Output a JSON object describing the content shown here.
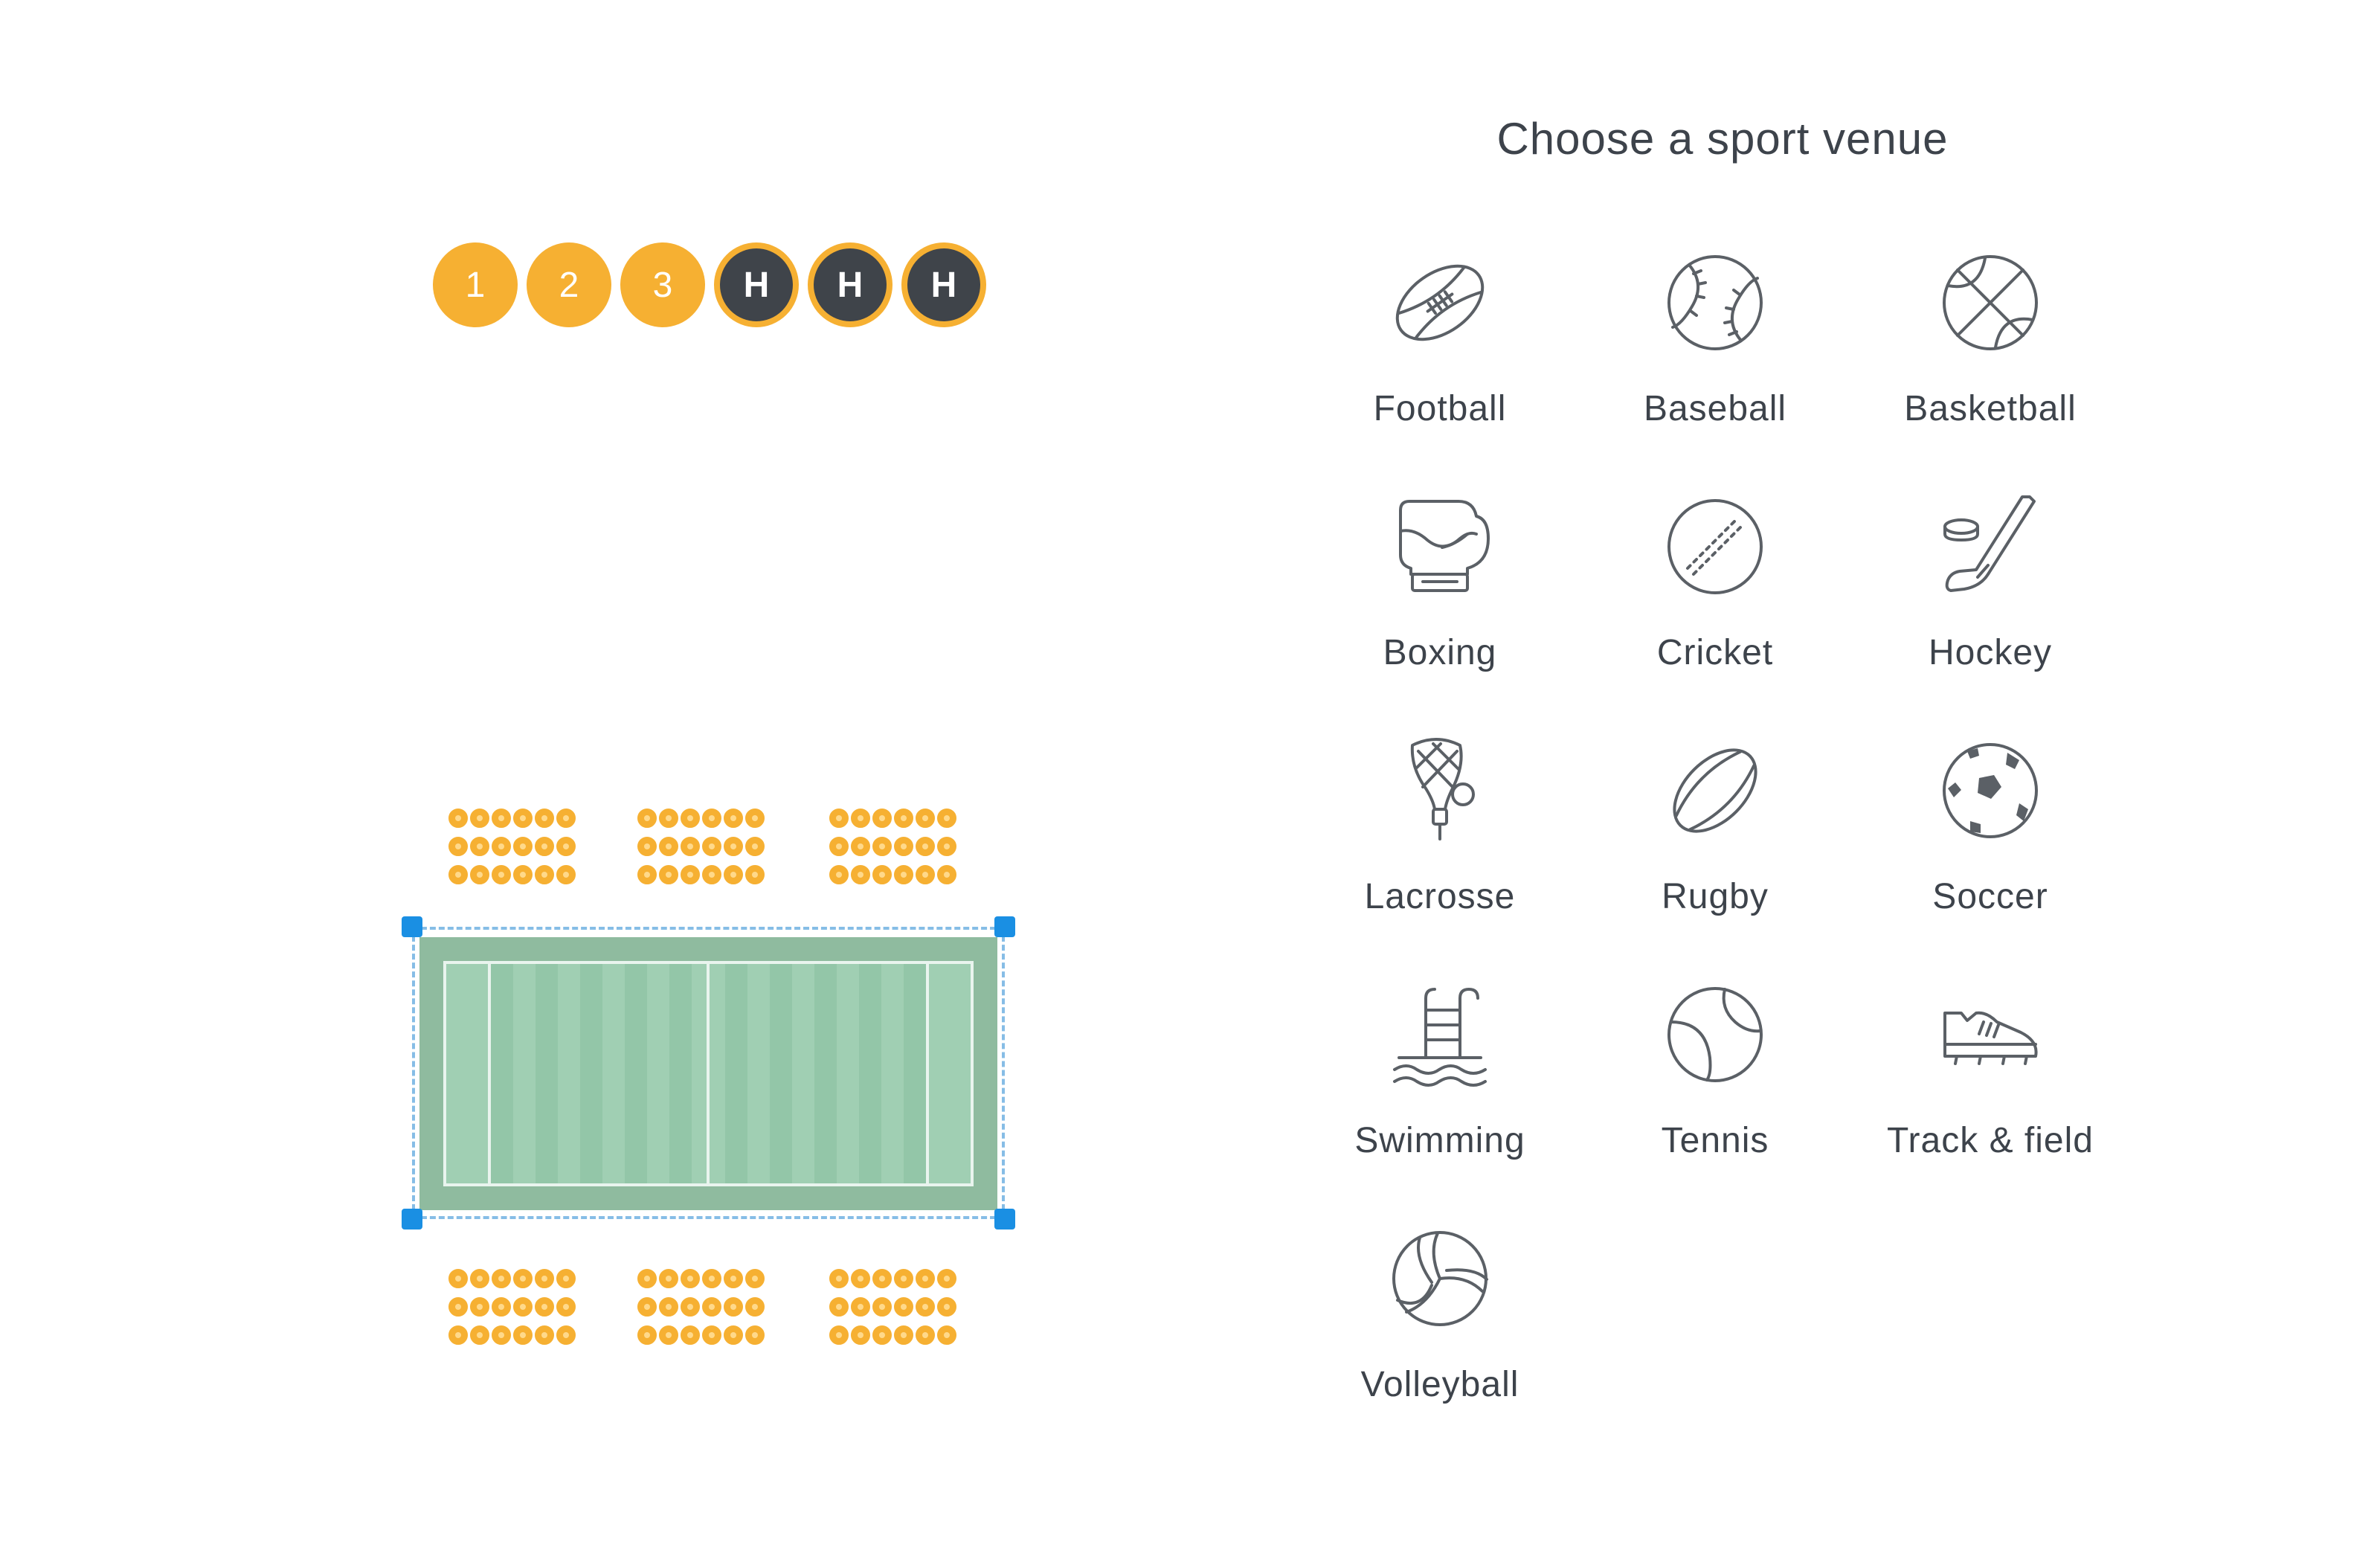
{
  "markers": [
    "1",
    "2",
    "3",
    "H",
    "H",
    "H"
  ],
  "panel": {
    "title": "Choose a sport venue",
    "venues": [
      {
        "label": "Football",
        "icon": "football-icon"
      },
      {
        "label": "Baseball",
        "icon": "baseball-icon"
      },
      {
        "label": "Basketball",
        "icon": "basketball-icon"
      },
      {
        "label": "Boxing",
        "icon": "boxing-glove-icon"
      },
      {
        "label": "Cricket",
        "icon": "cricket-ball-icon"
      },
      {
        "label": "Hockey",
        "icon": "hockey-stick-icon"
      },
      {
        "label": "Lacrosse",
        "icon": "lacrosse-stick-icon"
      },
      {
        "label": "Rugby",
        "icon": "rugby-ball-icon"
      },
      {
        "label": "Soccer",
        "icon": "soccer-ball-icon"
      },
      {
        "label": "Swimming",
        "icon": "swimming-pool-icon"
      },
      {
        "label": "Tennis",
        "icon": "tennis-ball-icon"
      },
      {
        "label": "Track & field",
        "icon": "track-shoe-icon"
      },
      {
        "label": "Volleyball",
        "icon": "volleyball-icon"
      }
    ]
  },
  "colors": {
    "seat": "#f6b032",
    "home_marker": "#3f444a",
    "court_outer": "#8fbb9f",
    "court_inner": "#a0cfb3",
    "selection": "#1a8fe3",
    "icon_stroke": "#5b6066"
  }
}
